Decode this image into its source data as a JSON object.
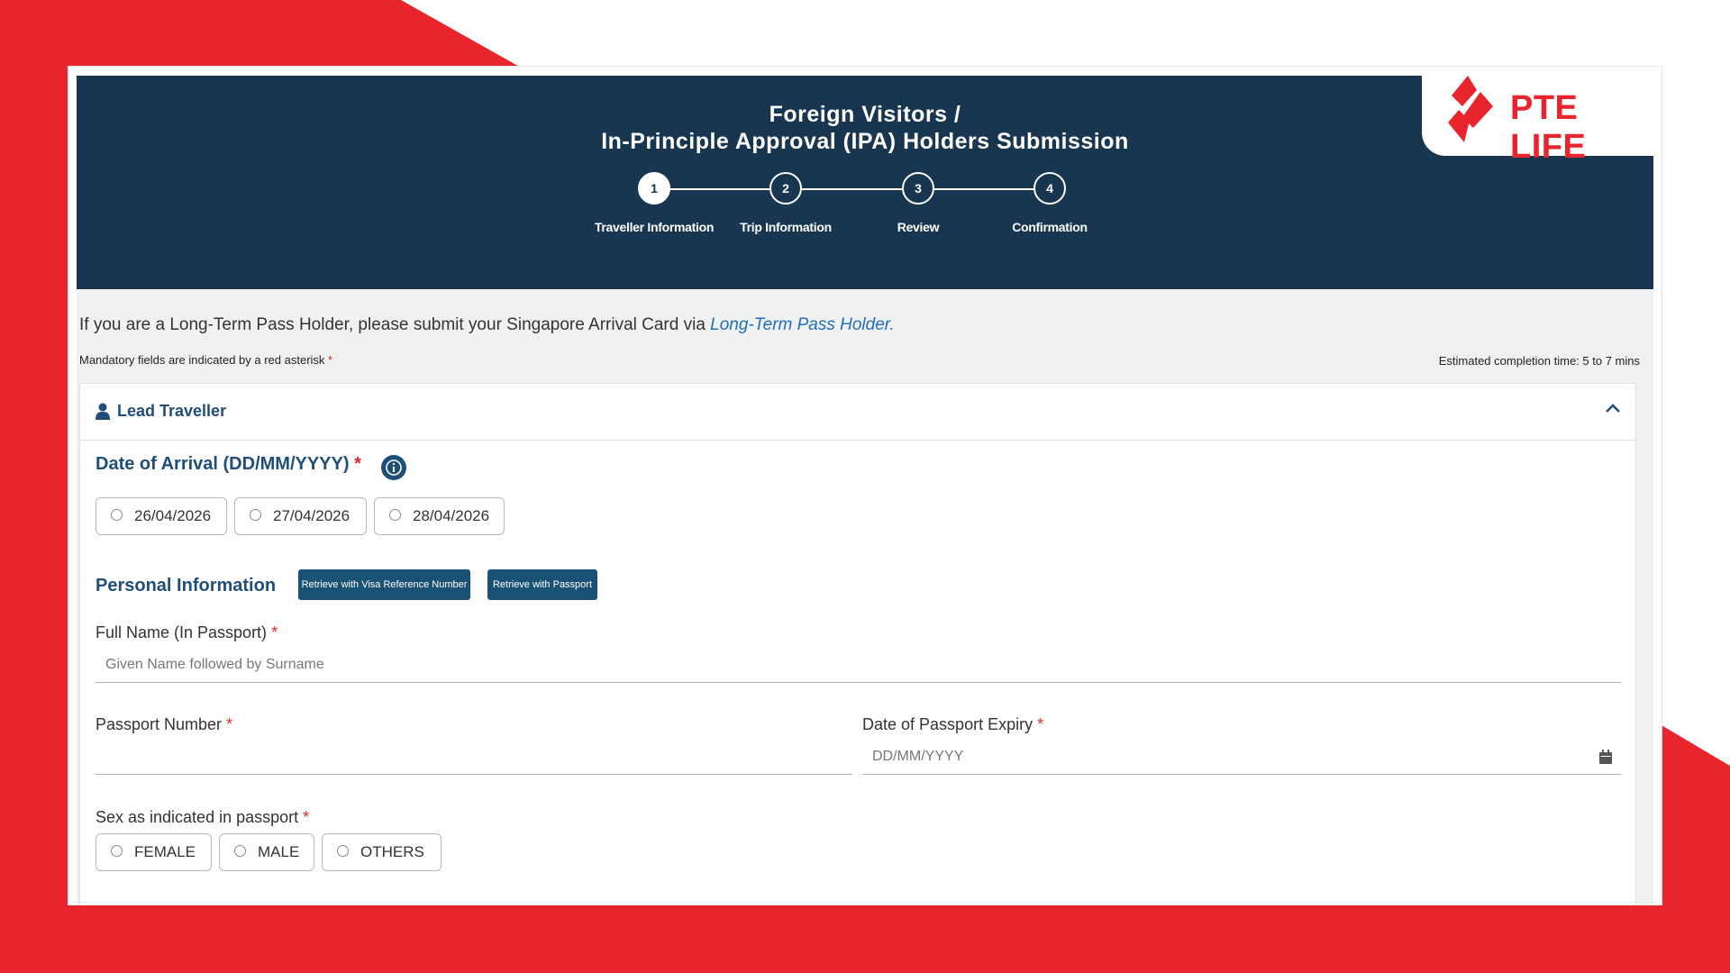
{
  "header": {
    "title_line1": "Foreign Visitors /",
    "title_line2": "In-Principle Approval (IPA) Holders Submission",
    "steps": [
      {
        "number": "1",
        "label": "Traveller Information"
      },
      {
        "number": "2",
        "label": "Trip Information"
      },
      {
        "number": "3",
        "label": "Review"
      },
      {
        "number": "4",
        "label": "Confirmation"
      }
    ],
    "active_step": 1
  },
  "logo": {
    "text": "PTE LIFE"
  },
  "intro": {
    "text": "If you are a Long-Term Pass Holder, please submit your Singapore Arrival Card via ",
    "link": "Long-Term Pass Holder."
  },
  "mandatory": {
    "text": "Mandatory fields are indicated by a red asterisk",
    "star": "*"
  },
  "estimate": "Estimated completion time: 5 to 7 mins",
  "lead": {
    "title": "Lead Traveller"
  },
  "arrival": {
    "label": "Date of Arrival (DD/MM/YYYY)",
    "star": "*",
    "options": [
      "26/04/2026",
      "27/04/2026",
      "28/04/2026"
    ]
  },
  "personal": {
    "title": "Personal Information",
    "visa_button": "Retrieve with Visa Reference Number",
    "passport_button": "Retrieve with Passport"
  },
  "full_name": {
    "label": "Full Name (In Passport)",
    "star": "*",
    "placeholder": "Given Name followed by Surname"
  },
  "passport_number": {
    "label": "Passport Number",
    "star": "*",
    "value": ""
  },
  "passport_expiry": {
    "label": "Date of Passport Expiry",
    "star": "*",
    "placeholder": "DD/MM/YYYY"
  },
  "sex": {
    "label": "Sex as indicated in passport",
    "star": "*",
    "options": [
      "FEMALE",
      "MALE",
      "OTHERS"
    ]
  },
  "colors": {
    "brand_red": "#e8242d",
    "header_navy": "#18364f",
    "heading_blue": "#1f4e79",
    "button_blue": "#1a5276"
  }
}
